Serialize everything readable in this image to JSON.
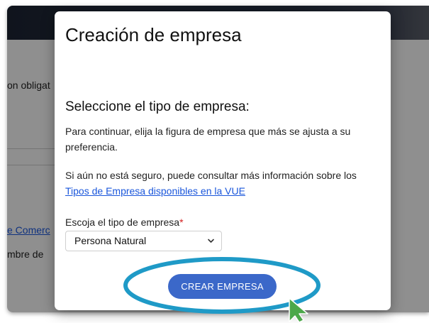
{
  "background": {
    "text_required": "on obligat",
    "link_comercio": "e Comerc",
    "text_nombre": "mbre de"
  },
  "modal": {
    "title": "Creación de empresa",
    "subtitle": "Seleccione el tipo de empresa:",
    "paragraph1": "Para continuar, elija la figura de empresa que más se ajusta a su preferencia.",
    "paragraph2_prefix": "Si aún no está seguro, puede consultar más información sobre los ",
    "paragraph2_link": "Tipos de Empresa disponibles en la VUE",
    "select_label": "Escoja el tipo de empresa",
    "required_mark": "*",
    "select_value": "Persona Natural",
    "create_button": "CREAR EMPRESA"
  },
  "colors": {
    "accent_button": "#3b68c9",
    "highlight_ring": "#1f9ac7",
    "cursor": "#4ca84a",
    "link": "#1a56db",
    "required": "#d32020"
  },
  "icons": {
    "select_chevron": "chevron-down-icon",
    "pointer": "cursor-arrow-icon"
  }
}
